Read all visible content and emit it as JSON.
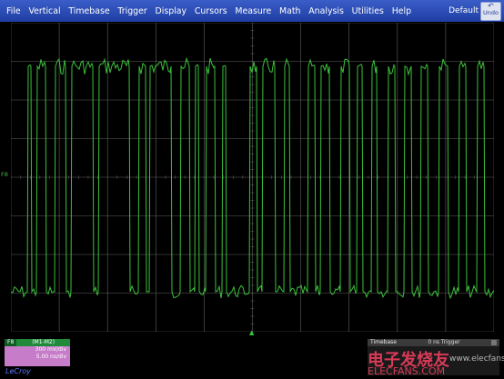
{
  "menu": {
    "items": [
      "File",
      "Vertical",
      "Timebase",
      "Trigger",
      "Display",
      "Cursors",
      "Measure",
      "Math",
      "Analysis",
      "Utilities",
      "Help"
    ],
    "default_label": "Default",
    "undo_label": "Undo"
  },
  "screen": {
    "trace_marker": "F8",
    "grid_color": "#606060",
    "trace_color": "#3cc03c"
  },
  "trace_panel": {
    "channel": "F8",
    "function": "(M1-M2)",
    "vdiv": "300 mV/div",
    "tdiv": "5.00 ns/div"
  },
  "logo": "LeCroy",
  "timebase_panel": {
    "label": "Timebase",
    "state": "0 ns  Trigger"
  },
  "watermark": {
    "text": "电子发烧友",
    "subtext": "ELECFANS.COM",
    "small": "www.elecfans.com"
  },
  "icons": {
    "undo": "undo-icon",
    "trigger": "trigger-arrow-icon"
  }
}
